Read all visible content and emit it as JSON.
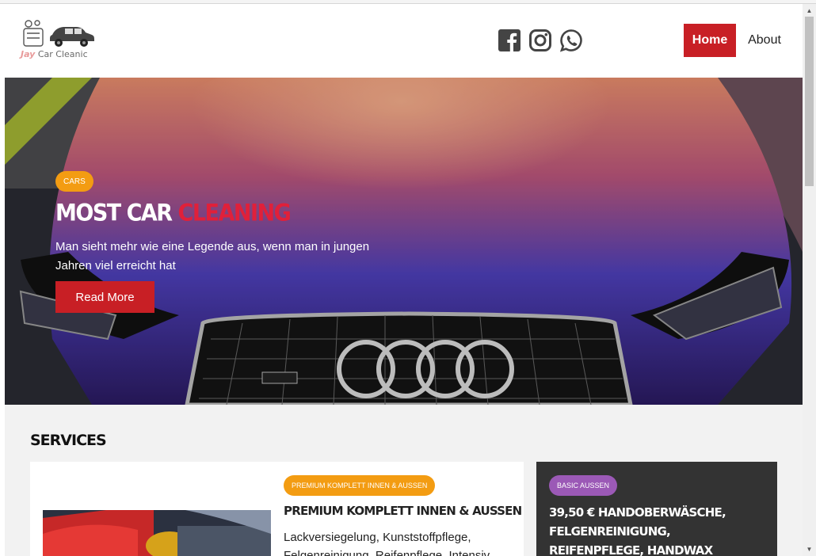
{
  "header": {
    "logo": {
      "brand": "Jay",
      "name": "Car Cleanic"
    },
    "social": [
      "facebook-icon",
      "instagram-icon",
      "whatsapp-icon"
    ],
    "nav": {
      "home": "Home",
      "about": "About"
    }
  },
  "hero": {
    "badge": "CARS",
    "title_main": "MOST CAR ",
    "title_accent": "CLEANING",
    "text": "Man sieht mehr wie eine Legende aus, wenn man in jungen Jahren viel erreicht hat",
    "button": "Read More"
  },
  "services": {
    "title": "SERVICES",
    "card1": {
      "badge": "PREMIUM KOMPLETT INNEN & AUSSEN",
      "title": "PREMIUM KOMPLETT INNEN & AUSSEN",
      "text": "Lackversiegelung, Kunststoffpflege, Felgenreinigung, Reifenpflege, Intensiv"
    },
    "card2": {
      "badge": "BASIC AUSSEN",
      "title": "39,50 € HANDOBERWÄSCHE, FELGENREINIGUNG, REIFENPFLEGE, HANDWAX"
    }
  },
  "scrollbar": {
    "up": "▲",
    "down": "▼"
  },
  "colors": {
    "brand_red": "#c81f25",
    "accent_red": "#e0203a",
    "badge_orange": "#f39c12",
    "badge_purple": "#9b59b6",
    "dark_card": "#333333"
  }
}
